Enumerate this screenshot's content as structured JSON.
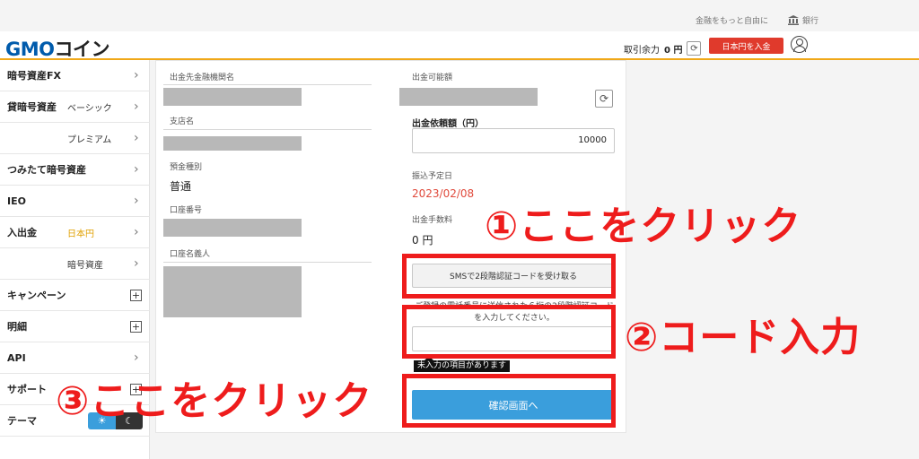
{
  "topbar": {
    "link_learn": "金融をもっと自由に",
    "link_bank": "銀行",
    "bank_icon": "bank-icon"
  },
  "header": {
    "logo_gmo": "GMO",
    "logo_coin": "コイン",
    "balance_label": "取引余力",
    "balance_value": "0 円",
    "deposit_button": "日本円を入金",
    "user_icon": "user-icon"
  },
  "sidebar": {
    "fx": "暗号資産FX",
    "lending": "貸暗号資産",
    "lending_basic": "ベーシック",
    "lending_premium": "プレミアム",
    "tsumitate": "つみたて暗号資産",
    "ieo": "IEO",
    "deposit_withdraw": "入出金",
    "dw_jpy": "日本円",
    "dw_crypto": "暗号資産",
    "campaign": "キャンペーン",
    "details": "明細",
    "api": "API",
    "support": "サポート",
    "theme": "テーマ",
    "chevron": "›",
    "plus": "+",
    "sun": "☀",
    "moon": "☾"
  },
  "form": {
    "bank_name_label": "出金先金融機関名",
    "branch_label": "支店名",
    "account_type_label": "預金種別",
    "account_type_value": "普通",
    "account_number_label": "口座番号",
    "account_holder_label": "口座名義人",
    "available_label": "出金可能額",
    "request_amount_label": "出金依頼額（円）",
    "request_amount_value": "10000",
    "transfer_date_label": "振込予定日",
    "transfer_date_value": "2023/02/08",
    "fee_label": "出金手数料",
    "fee_value": "0 円",
    "sms_button": "SMSで2段階認証コードを受け取る",
    "sms_note": "ご登録の電話番号に送信された６桁の2段階認証コードを入力してください。",
    "code_placeholder": "",
    "error_tip": "未入力の項目があります",
    "confirm_button": "確認画面へ",
    "refresh_icon": "⟳"
  },
  "annotations": {
    "step1": "①ここをクリック",
    "step2": "②コード入力",
    "step3": "③ここをクリック",
    "color": "#ee1c1c"
  }
}
